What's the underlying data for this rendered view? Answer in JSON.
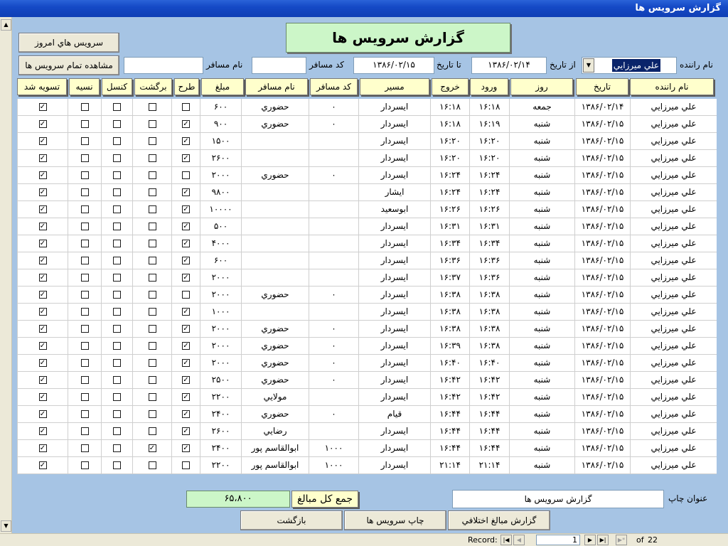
{
  "window": {
    "title": "گزارش سرويس ها"
  },
  "form": {
    "title": "گزارش سرويس ها"
  },
  "toolbar": {
    "today_services_label": "سرويس هاي امروز",
    "all_services_label": "مشاهده تمام سرويس ها"
  },
  "filters": {
    "driver_label": "نام راننده",
    "driver_value": "علي ميرزايي",
    "from_date_label": "از تاريخ",
    "from_date_value": "۱۳۸۶/۰۲/۱۴",
    "to_date_label": "تا تاريخ",
    "to_date_value": "۱۳۸۶/۰۲/۱۵",
    "passenger_code_label": "کد مسافر",
    "passenger_code_value": "",
    "passenger_name_label": "نام مسافر",
    "passenger_name_value": ""
  },
  "columns": [
    "نام راننده",
    "تاريخ",
    "روز",
    "ورود",
    "خروج",
    "مسير",
    "کد مسافر",
    "نام مسافر",
    "مبلغ",
    "طرح",
    "برگشت",
    "کنسل",
    "نسيه",
    "تسويه شد"
  ],
  "rows": [
    {
      "driver": "علي ميرزايي",
      "date": "۱۳۸۶/۰۲/۱۴",
      "day": "جمعه",
      "in": "۱۶:۱۸",
      "out": "۱۶:۱۸",
      "route": "ايسردار",
      "code": "۰",
      "name": "حضوري",
      "amount": "۶۰۰",
      "tarh": false,
      "bargasht": false,
      "cancel": false,
      "nesieh": false,
      "settled": true
    },
    {
      "driver": "علي ميرزايي",
      "date": "۱۳۸۶/۰۲/۱۵",
      "day": "شنبه",
      "in": "۱۶:۱۹",
      "out": "۱۶:۱۸",
      "route": "ايسردار",
      "code": "۰",
      "name": "حضوري",
      "amount": "۹۰۰",
      "tarh": true,
      "bargasht": false,
      "cancel": false,
      "nesieh": false,
      "settled": true
    },
    {
      "driver": "علي ميرزايي",
      "date": "۱۳۸۶/۰۲/۱۵",
      "day": "شنبه",
      "in": "۱۶:۲۰",
      "out": "۱۶:۲۰",
      "route": "ايسردار",
      "code": "",
      "name": "",
      "amount": "۱۵۰۰",
      "tarh": true,
      "bargasht": false,
      "cancel": false,
      "nesieh": false,
      "settled": true
    },
    {
      "driver": "علي ميرزايي",
      "date": "۱۳۸۶/۰۲/۱۵",
      "day": "شنبه",
      "in": "۱۶:۲۰",
      "out": "۱۶:۲۰",
      "route": "ايسردار",
      "code": "",
      "name": "",
      "amount": "۲۶۰۰",
      "tarh": true,
      "bargasht": false,
      "cancel": false,
      "nesieh": false,
      "settled": true
    },
    {
      "driver": "علي ميرزايي",
      "date": "۱۳۸۶/۰۲/۱۵",
      "day": "شنبه",
      "in": "۱۶:۲۴",
      "out": "۱۶:۲۴",
      "route": "ايسردار",
      "code": "۰",
      "name": "حضوري",
      "amount": "۲۰۰۰",
      "tarh": false,
      "bargasht": false,
      "cancel": false,
      "nesieh": false,
      "settled": true
    },
    {
      "driver": "علي ميرزايي",
      "date": "۱۳۸۶/۰۲/۱۵",
      "day": "شنبه",
      "in": "۱۶:۲۴",
      "out": "۱۶:۲۴",
      "route": "ايشار",
      "code": "",
      "name": "",
      "amount": "۹۸۰۰",
      "tarh": true,
      "bargasht": false,
      "cancel": false,
      "nesieh": false,
      "settled": true
    },
    {
      "driver": "علي ميرزايي",
      "date": "۱۳۸۶/۰۲/۱۵",
      "day": "شنبه",
      "in": "۱۶:۲۶",
      "out": "۱۶:۲۶",
      "route": "ابوسعيد",
      "code": "",
      "name": "",
      "amount": "۱۰۰۰۰",
      "tarh": true,
      "bargasht": false,
      "cancel": false,
      "nesieh": false,
      "settled": true
    },
    {
      "driver": "علي ميرزايي",
      "date": "۱۳۸۶/۰۲/۱۵",
      "day": "شنبه",
      "in": "۱۶:۳۱",
      "out": "۱۶:۳۱",
      "route": "ايسردار",
      "code": "",
      "name": "",
      "amount": "۵۰۰",
      "tarh": true,
      "bargasht": false,
      "cancel": false,
      "nesieh": false,
      "settled": true
    },
    {
      "driver": "علي ميرزايي",
      "date": "۱۳۸۶/۰۲/۱۵",
      "day": "شنبه",
      "in": "۱۶:۳۴",
      "out": "۱۶:۳۴",
      "route": "ايسردار",
      "code": "",
      "name": "",
      "amount": "۴۰۰۰",
      "tarh": true,
      "bargasht": false,
      "cancel": false,
      "nesieh": false,
      "settled": true
    },
    {
      "driver": "علي ميرزايي",
      "date": "۱۳۸۶/۰۲/۱۵",
      "day": "شنبه",
      "in": "۱۶:۳۶",
      "out": "۱۶:۳۶",
      "route": "ايسردار",
      "code": "",
      "name": "",
      "amount": "۶۰۰",
      "tarh": true,
      "bargasht": false,
      "cancel": false,
      "nesieh": false,
      "settled": true
    },
    {
      "driver": "علي ميرزايي",
      "date": "۱۳۸۶/۰۲/۱۵",
      "day": "شنبه",
      "in": "۱۶:۳۶",
      "out": "۱۶:۳۷",
      "route": "ايسردار",
      "code": "",
      "name": "",
      "amount": "۲۰۰۰",
      "tarh": true,
      "bargasht": false,
      "cancel": false,
      "nesieh": false,
      "settled": true
    },
    {
      "driver": "علي ميرزايي",
      "date": "۱۳۸۶/۰۲/۱۵",
      "day": "شنبه",
      "in": "۱۶:۳۸",
      "out": "۱۶:۳۸",
      "route": "ايسردار",
      "code": "۰",
      "name": "حضوري",
      "amount": "۲۰۰۰",
      "tarh": false,
      "bargasht": false,
      "cancel": false,
      "nesieh": false,
      "settled": true
    },
    {
      "driver": "علي ميرزايي",
      "date": "۱۳۸۶/۰۲/۱۵",
      "day": "شنبه",
      "in": "۱۶:۳۸",
      "out": "۱۶:۳۸",
      "route": "ايسردار",
      "code": "",
      "name": "",
      "amount": "۱۰۰۰",
      "tarh": true,
      "bargasht": false,
      "cancel": false,
      "nesieh": false,
      "settled": true
    },
    {
      "driver": "علي ميرزايي",
      "date": "۱۳۸۶/۰۲/۱۵",
      "day": "شنبه",
      "in": "۱۶:۳۸",
      "out": "۱۶:۳۸",
      "route": "ايسردار",
      "code": "۰",
      "name": "حضوري",
      "amount": "۲۰۰۰",
      "tarh": true,
      "bargasht": false,
      "cancel": false,
      "nesieh": false,
      "settled": true
    },
    {
      "driver": "علي ميرزايي",
      "date": "۱۳۸۶/۰۲/۱۵",
      "day": "شنبه",
      "in": "۱۶:۳۸",
      "out": "۱۶:۳۹",
      "route": "ايسردار",
      "code": "۰",
      "name": "حضوري",
      "amount": "۲۰۰۰",
      "tarh": true,
      "bargasht": false,
      "cancel": false,
      "nesieh": false,
      "settled": true
    },
    {
      "driver": "علي ميرزايي",
      "date": "۱۳۸۶/۰۲/۱۵",
      "day": "شنبه",
      "in": "۱۶:۴۰",
      "out": "۱۶:۴۰",
      "route": "ايسردار",
      "code": "۰",
      "name": "حضوري",
      "amount": "۲۰۰۰",
      "tarh": true,
      "bargasht": false,
      "cancel": false,
      "nesieh": false,
      "settled": true
    },
    {
      "driver": "علي ميرزايي",
      "date": "۱۳۸۶/۰۲/۱۵",
      "day": "شنبه",
      "in": "۱۶:۴۲",
      "out": "۱۶:۴۲",
      "route": "ايسردار",
      "code": "۰",
      "name": "حضوري",
      "amount": "۲۵۰۰",
      "tarh": true,
      "bargasht": false,
      "cancel": false,
      "nesieh": false,
      "settled": true
    },
    {
      "driver": "علي ميرزايي",
      "date": "۱۳۸۶/۰۲/۱۵",
      "day": "شنبه",
      "in": "۱۶:۴۲",
      "out": "۱۶:۴۲",
      "route": "ايسردار",
      "code": "",
      "name": "مولايي",
      "amount": "۲۲۰۰",
      "tarh": true,
      "bargasht": false,
      "cancel": false,
      "nesieh": false,
      "settled": true
    },
    {
      "driver": "علي ميرزايي",
      "date": "۱۳۸۶/۰۲/۱۵",
      "day": "شنبه",
      "in": "۱۶:۴۴",
      "out": "۱۶:۴۴",
      "route": "قيام",
      "code": "۰",
      "name": "حضوري",
      "amount": "۲۴۰۰",
      "tarh": true,
      "bargasht": false,
      "cancel": false,
      "nesieh": false,
      "settled": true
    },
    {
      "driver": "علي ميرزايي",
      "date": "۱۳۸۶/۰۲/۱۵",
      "day": "شنبه",
      "in": "۱۶:۴۴",
      "out": "۱۶:۴۴",
      "route": "ايسردار",
      "code": "",
      "name": "رضايي",
      "amount": "۲۶۰۰",
      "tarh": true,
      "bargasht": false,
      "cancel": false,
      "nesieh": false,
      "settled": true
    },
    {
      "driver": "علي ميرزايي",
      "date": "۱۳۸۶/۰۲/۱۵",
      "day": "شنبه",
      "in": "۱۶:۴۴",
      "out": "۱۶:۴۴",
      "route": "ايسردار",
      "code": "۱۰۰۰",
      "name": "ابوالقاسم پور",
      "amount": "۲۴۰۰",
      "tarh": true,
      "bargasht": true,
      "cancel": false,
      "nesieh": false,
      "settled": true
    },
    {
      "driver": "علي ميرزايي",
      "date": "۱۳۸۶/۰۲/۱۵",
      "day": "شنبه",
      "in": "۲۱:۱۴",
      "out": "۲۱:۱۴",
      "route": "ايسردار",
      "code": "۱۰۰۰",
      "name": "ابوالقاسم پور",
      "amount": "۲۲۰۰",
      "tarh": false,
      "bargasht": false,
      "cancel": false,
      "nesieh": false,
      "settled": true
    }
  ],
  "total": {
    "label": "جمع کل مبالغ",
    "value": "۶۵،۸۰۰"
  },
  "print_title": {
    "label": "عنوان چاپ",
    "value": "گزارش سرويس ها"
  },
  "buttons": {
    "diff_report": "گزارش مبالغ اختلافي",
    "print_services": "چاپ سرويس ها",
    "back": "بازگشت"
  },
  "record_nav": {
    "label": "Record:",
    "current": "1",
    "of_label": "of",
    "total": "22"
  },
  "icons": {
    "scroll_up": "scroll-up-arrow-icon",
    "scroll_down": "scroll-down-arrow-icon",
    "nav_first": "first-record-icon",
    "nav_prev": "previous-record-icon",
    "nav_next": "next-record-icon",
    "nav_last": "last-record-icon",
    "nav_new": "new-record-icon",
    "dropdown": "dropdown-arrow-icon"
  }
}
